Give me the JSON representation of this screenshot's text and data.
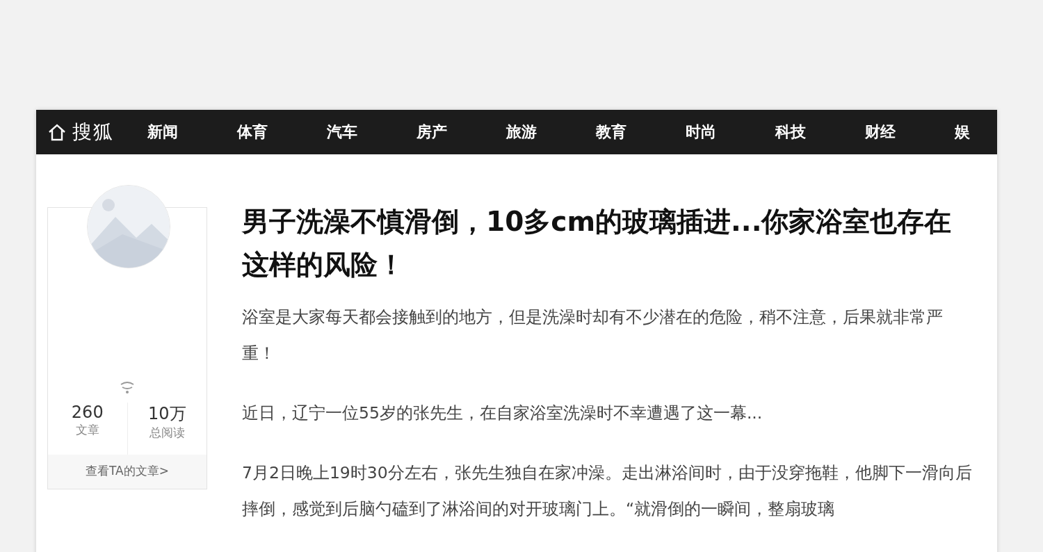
{
  "nav": {
    "logo": "搜狐",
    "items": [
      "新闻",
      "体育",
      "汽车",
      "房产",
      "旅游",
      "教育",
      "时尚",
      "科技",
      "财经",
      "娱"
    ]
  },
  "author_card": {
    "stats": [
      {
        "value": "260",
        "label": "文章"
      },
      {
        "value": "10万",
        "label": "总阅读"
      }
    ],
    "link": "查看TA的文章>"
  },
  "article": {
    "title": "男子洗澡不慎滑倒，10多cm的玻璃插进...你家浴室也存在这样的风险！",
    "paragraphs": [
      "浴室是大家每天都会接触到的地方，但是洗澡时却有不少潜在的危险，稍不注意，后果就非常严重！",
      "近日，辽宁一位55岁的张先生，在自家浴室洗澡时不幸遭遇了这一幕...",
      "7月2日晚上19时30分左右，张先生独自在家冲澡。走出淋浴间时，由于没穿拖鞋，他脚下一滑向后摔倒，感觉到后脑勺磕到了淋浴间的对开玻璃门上。“就滑倒的一瞬间，整扇玻璃"
    ]
  }
}
